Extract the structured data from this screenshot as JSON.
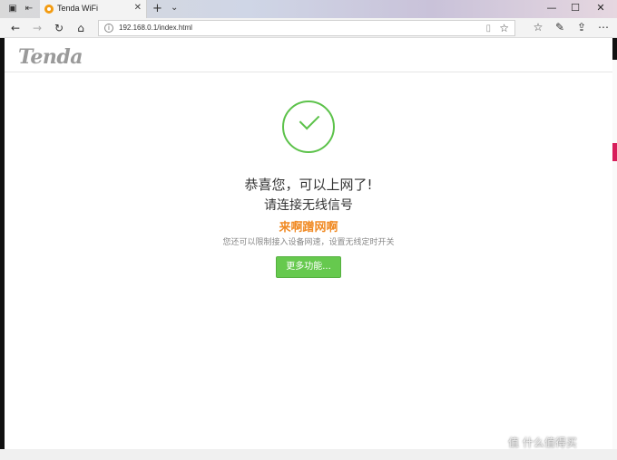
{
  "browser": {
    "tab": {
      "title": "Tenda WiFi",
      "close": "✕"
    },
    "new_tab": "+",
    "tab_menu": "⌄",
    "controls": {
      "minimize": "—",
      "maximize": "☐",
      "close": "✕"
    },
    "nav": {
      "back": "←",
      "forward": "→",
      "refresh": "↻",
      "home": "⌂"
    },
    "address": {
      "url": "192.168.0.1/index.html",
      "info": "i",
      "reading_view": "▯",
      "favorite": "☆"
    },
    "tools": {
      "favorites_list": "☆",
      "notes": "✎",
      "share": "⇪",
      "more": "⋯"
    }
  },
  "page": {
    "logo": "Tenda",
    "success_line": "恭喜您，可以上网了!",
    "connect_line": "请连接无线信号",
    "highlight": "来啊蹭网啊",
    "hint": "您还可以限制接入设备网速，设置无线定时开关",
    "more_button": "更多功能..."
  },
  "watermark": "值 什么值得买",
  "colors": {
    "accent_green": "#66c94e",
    "highlight_orange": "#f08a24",
    "logo_gray": "#9a9a9a"
  }
}
